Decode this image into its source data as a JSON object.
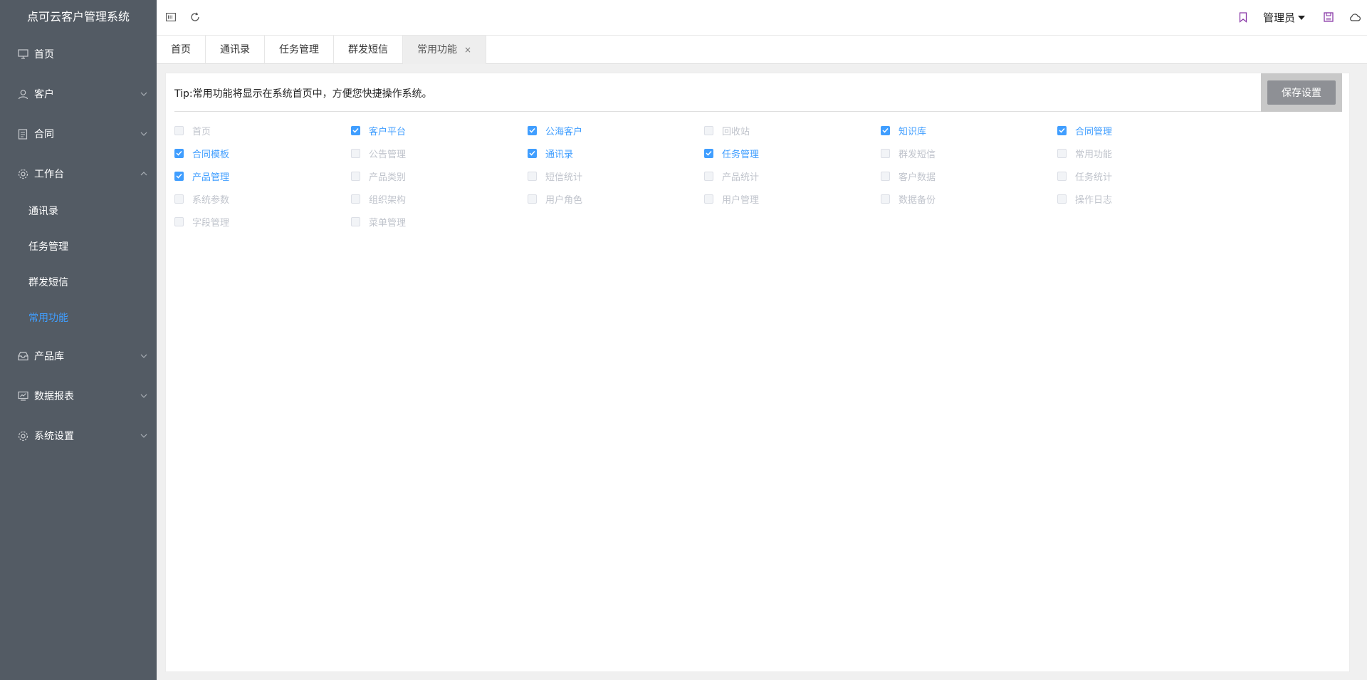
{
  "brand": "点可云客户管理系统",
  "sidebar": {
    "items": [
      {
        "label": "首页",
        "icon": "monitor-icon"
      },
      {
        "label": "客户",
        "icon": "user-icon"
      },
      {
        "label": "合同",
        "icon": "document-icon"
      },
      {
        "label": "工作台",
        "icon": "gear-icon"
      },
      {
        "label": "产品库",
        "icon": "inbox-icon"
      },
      {
        "label": "数据报表",
        "icon": "chart-icon"
      },
      {
        "label": "系统设置",
        "icon": "settings-icon"
      }
    ],
    "workbench_sub": [
      "通讯录",
      "任务管理",
      "群发短信",
      "常用功能"
    ],
    "active_sub": "常用功能"
  },
  "header": {
    "admin_label": "管理员",
    "icons": [
      "collapse-icon",
      "refresh-icon",
      "bookmark-icon",
      "save-icon",
      "cloud-icon"
    ]
  },
  "tabs": [
    {
      "label": "首页"
    },
    {
      "label": "通讯录"
    },
    {
      "label": "任务管理"
    },
    {
      "label": "群发短信"
    },
    {
      "label": "常用功能",
      "active": true,
      "close": "×"
    }
  ],
  "content": {
    "tip": "Tip:常用功能将显示在系统首页中，方便您快捷操作系统。",
    "save_label": "保存设置",
    "options": [
      {
        "label": "首页",
        "checked": false
      },
      {
        "label": "客户平台",
        "checked": true
      },
      {
        "label": "公海客户",
        "checked": true
      },
      {
        "label": "回收站",
        "checked": false
      },
      {
        "label": "知识库",
        "checked": true
      },
      {
        "label": "合同管理",
        "checked": true
      },
      {
        "label": "合同模板",
        "checked": true
      },
      {
        "label": "公告管理",
        "checked": false
      },
      {
        "label": "通讯录",
        "checked": true
      },
      {
        "label": "任务管理",
        "checked": true
      },
      {
        "label": "群发短信",
        "checked": false
      },
      {
        "label": "常用功能",
        "checked": false
      },
      {
        "label": "产品管理",
        "checked": true
      },
      {
        "label": "产品类别",
        "checked": false
      },
      {
        "label": "短信统计",
        "checked": false
      },
      {
        "label": "产品统计",
        "checked": false
      },
      {
        "label": "客户数据",
        "checked": false
      },
      {
        "label": "任务统计",
        "checked": false
      },
      {
        "label": "系统参数",
        "checked": false
      },
      {
        "label": "组织架构",
        "checked": false
      },
      {
        "label": "用户角色",
        "checked": false
      },
      {
        "label": "用户管理",
        "checked": false
      },
      {
        "label": "数据备份",
        "checked": false
      },
      {
        "label": "操作日志",
        "checked": false
      },
      {
        "label": "字段管理",
        "checked": false
      },
      {
        "label": "菜单管理",
        "checked": false
      }
    ]
  },
  "colors": {
    "sidebar_bg": "#535b64",
    "accent": "#409eff",
    "save_button": "#8e9095"
  }
}
